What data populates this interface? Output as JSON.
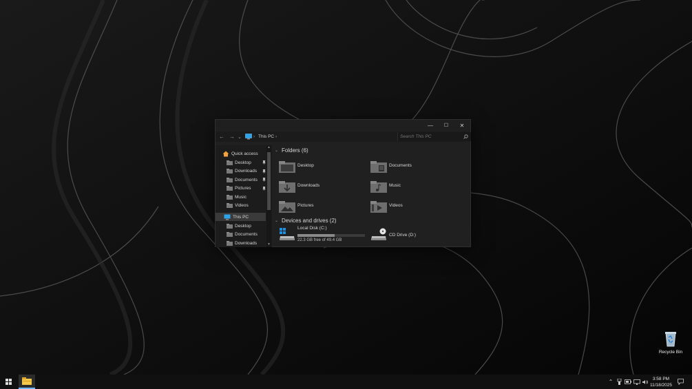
{
  "window": {
    "title_buttons": {
      "minimize": "—",
      "maximize": "☐",
      "close": "✕"
    },
    "address": {
      "back": "←",
      "forward": "→",
      "recent": "⌄",
      "location": "This PC",
      "sep": "›"
    },
    "search": {
      "placeholder": "Search This PC"
    }
  },
  "nav": {
    "quick_access": "Quick access",
    "quick_items": [
      {
        "label": "Desktop",
        "pinned": true
      },
      {
        "label": "Downloads",
        "pinned": true
      },
      {
        "label": "Documents",
        "pinned": true
      },
      {
        "label": "Pictures",
        "pinned": true
      },
      {
        "label": "Music",
        "pinned": false
      },
      {
        "label": "Videos",
        "pinned": false
      }
    ],
    "this_pc": "This PC",
    "pc_items": [
      "Desktop",
      "Documents",
      "Downloads"
    ]
  },
  "content": {
    "folders_header": "Folders (6)",
    "folders": [
      {
        "label": "Desktop",
        "icon": "desktop-folder-icon"
      },
      {
        "label": "Documents",
        "icon": "documents-folder-icon"
      },
      {
        "label": "Downloads",
        "icon": "downloads-folder-icon"
      },
      {
        "label": "Music",
        "icon": "music-folder-icon"
      },
      {
        "label": "Pictures",
        "icon": "pictures-folder-icon"
      },
      {
        "label": "Videos",
        "icon": "videos-folder-icon"
      }
    ],
    "drives_header": "Devices and drives (2)",
    "drives": [
      {
        "label": "Local Disk (C:)",
        "free_text": "22.3 GB free of 49.4 GB",
        "used_fraction": 0.55,
        "icon": "local-disk-icon"
      },
      {
        "label": "CD Drive (D:)",
        "icon": "cd-drive-icon"
      }
    ]
  },
  "desktop": {
    "recycle_bin": "Recycle Bin"
  },
  "taskbar": {
    "time": "3:58 PM",
    "date": "11/18/2025",
    "icons": [
      "start-icon",
      "file-explorer-icon",
      "chevron-up-icon",
      "usb-icon",
      "battery-icon",
      "network-icon",
      "volume-icon",
      "notification-icon"
    ]
  },
  "colors": {
    "folder": "#7a7a7a",
    "accent_blue": "#3aa0e8",
    "window_bg": "#202020"
  }
}
